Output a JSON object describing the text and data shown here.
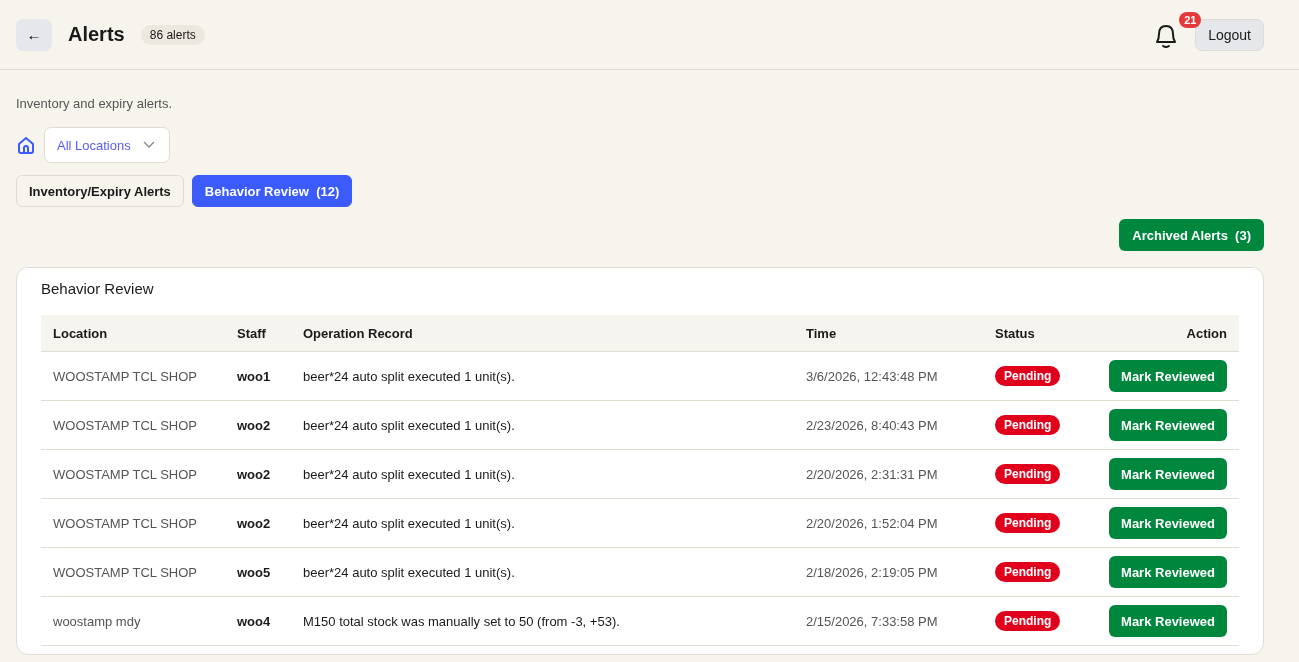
{
  "header": {
    "back_button": "←",
    "title": "Alerts",
    "count_badge": "86 alerts",
    "notifications": "21",
    "logout_button": "Logout"
  },
  "subtitle": "Inventory and expiry alerts.",
  "location_select": {
    "value": "All Locations"
  },
  "tabs": [
    {
      "label": "Inventory/Expiry Alerts",
      "selected": false
    },
    {
      "label": "Behavior Review  (12)",
      "selected": true
    }
  ],
  "archived_button": "Archived Alerts  (3)",
  "panel": {
    "title": "Behavior Review",
    "table": {
      "columns": [
        "Location",
        "Staff",
        "Operation Record",
        "Time",
        "Status",
        "Action"
      ],
      "rows": [
        {
          "location": "WOOSTAMP TCL SHOP",
          "staff": "woo1",
          "record": "beer*24 auto split executed 1 unit(s).",
          "time": "3/6/2026, 12:43:48 PM",
          "status": {
            "label": "Pending",
            "kind": "pending"
          },
          "action": "Mark Reviewed"
        },
        {
          "location": "WOOSTAMP TCL SHOP",
          "staff": "woo2",
          "record": "beer*24 auto split executed 1 unit(s).",
          "time": "2/23/2026, 8:40:43 PM",
          "status": {
            "label": "Pending",
            "kind": "pending"
          },
          "action": "Mark Reviewed"
        },
        {
          "location": "WOOSTAMP TCL SHOP",
          "staff": "woo2",
          "record": "beer*24 auto split executed 1 unit(s).",
          "time": "2/20/2026, 2:31:31 PM",
          "status": {
            "label": "Pending",
            "kind": "pending"
          },
          "action": "Mark Reviewed"
        },
        {
          "location": "WOOSTAMP TCL SHOP",
          "staff": "woo2",
          "record": "beer*24 auto split executed 1 unit(s).",
          "time": "2/20/2026, 1:52:04 PM",
          "status": {
            "label": "Pending",
            "kind": "pending"
          },
          "action": "Mark Reviewed"
        },
        {
          "location": "WOOSTAMP TCL SHOP",
          "staff": "woo5",
          "record": "beer*24 auto split executed 1 unit(s).",
          "time": "2/18/2026, 2:19:05 PM",
          "status": {
            "label": "Pending",
            "kind": "pending"
          },
          "action": "Mark Reviewed"
        },
        {
          "location": "woostamp mdy",
          "staff": "woo4",
          "record": "M150 total stock was manually set to 50 (from -3, +53).",
          "time": "2/15/2026, 7:33:58 PM",
          "status": {
            "label": "Pending",
            "kind": "pending"
          },
          "action": "Mark Reviewed"
        }
      ]
    }
  }
}
